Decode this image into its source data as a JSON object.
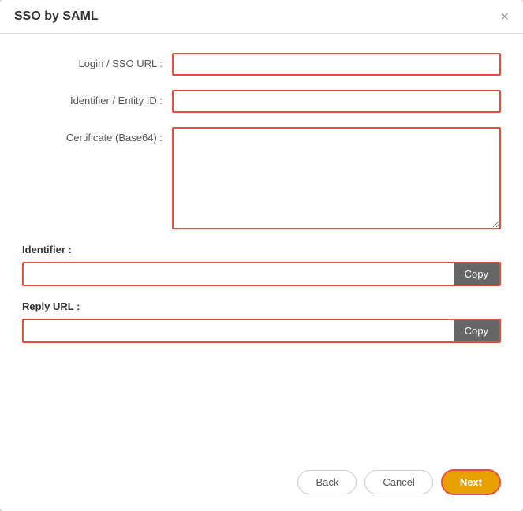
{
  "modal": {
    "title": "SSO by SAML",
    "close_label": "×"
  },
  "form": {
    "login_url_label": "Login / SSO URL :",
    "login_url_value": "",
    "login_url_placeholder": "",
    "entity_id_label": "Identifier / Entity ID :",
    "entity_id_value": "",
    "entity_id_placeholder": "",
    "certificate_label": "Certificate (Base64) :",
    "certificate_value": "",
    "certificate_placeholder": "",
    "identifier_section_label": "Identifier :",
    "identifier_value": "",
    "copy_identifier_label": "Copy",
    "reply_url_section_label": "Reply URL :",
    "reply_url_value": "",
    "copy_reply_url_label": "Copy"
  },
  "footer": {
    "back_label": "Back",
    "cancel_label": "Cancel",
    "next_label": "Next"
  }
}
